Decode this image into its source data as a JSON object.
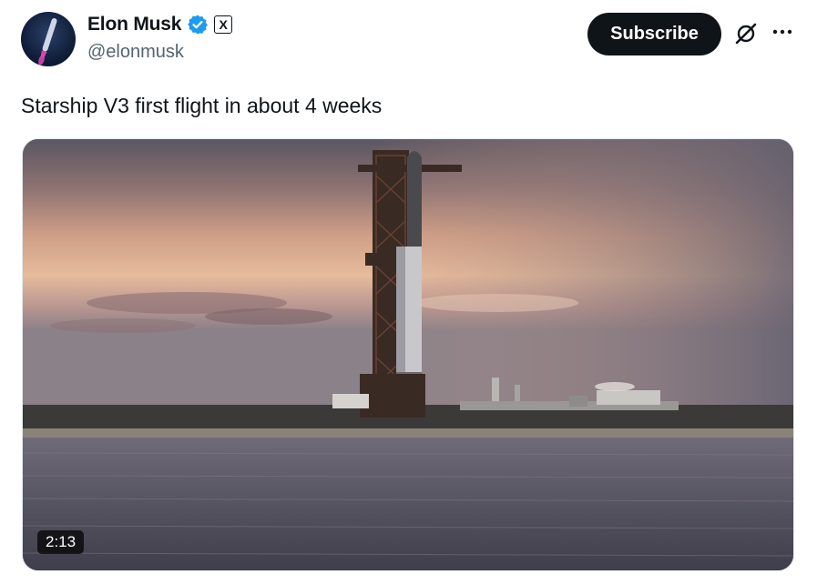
{
  "author": {
    "display_name": "Elon Musk",
    "handle": "@elonmusk",
    "verified": true,
    "affiliate_badge": "X"
  },
  "actions": {
    "subscribe_label": "Subscribe"
  },
  "tweet": {
    "text": "Starship V3 first flight in about 4 weeks"
  },
  "media": {
    "type": "video",
    "duration": "2:13"
  },
  "icons": {
    "verified": "verified-badge-icon",
    "grok": "grok-icon",
    "more": "more-options-icon"
  },
  "colors": {
    "verified_blue": "#1d9bf0",
    "subscribe_bg": "#0f1419",
    "handle_gray": "#536471"
  }
}
